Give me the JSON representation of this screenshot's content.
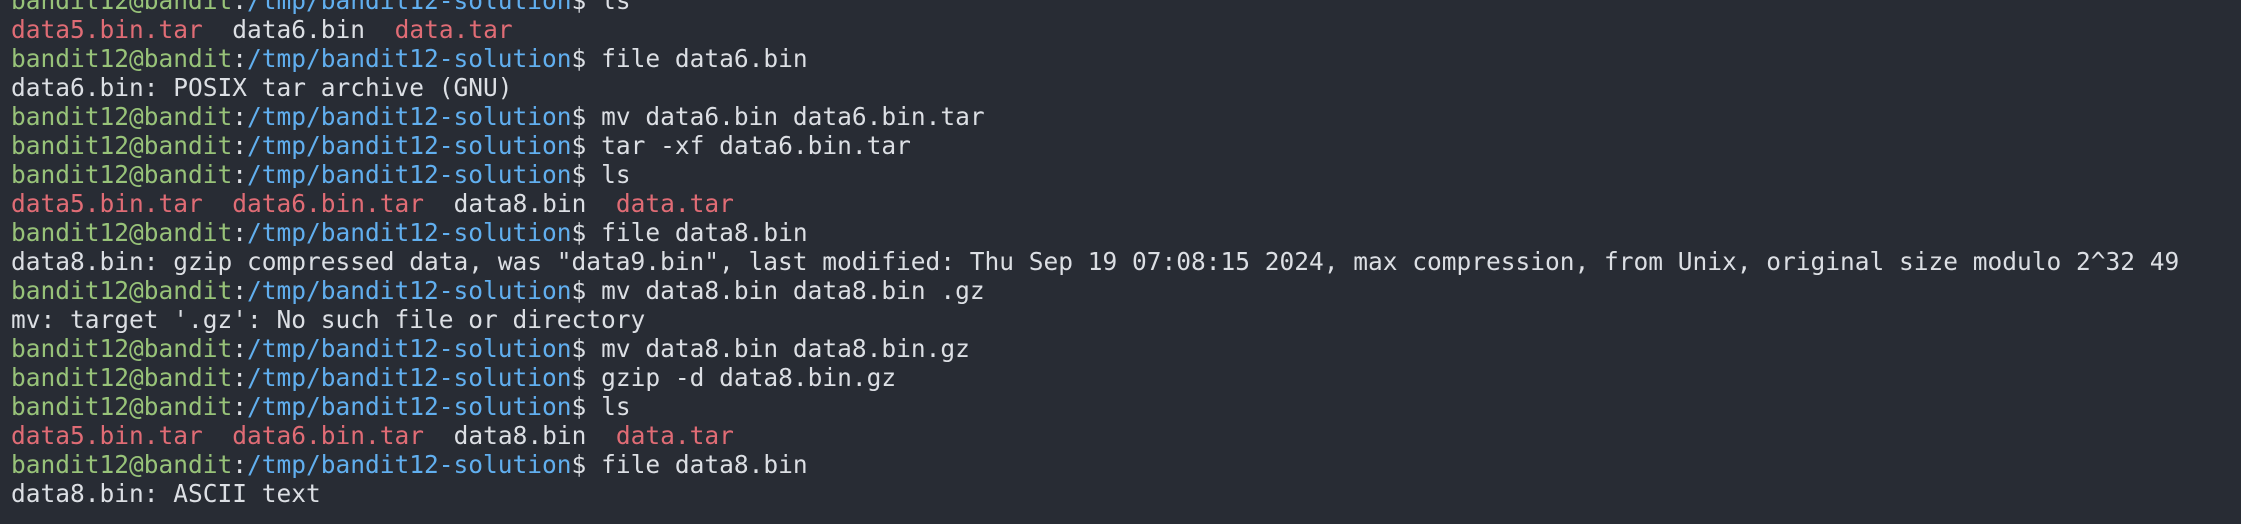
{
  "colors": {
    "background": "#282c34",
    "prompt_user": "#98c379",
    "prompt_path": "#61afef",
    "archive_file": "#e06c75",
    "text": "#dcdfe4"
  },
  "prompt": {
    "user_host": "bandit12@bandit",
    "sep": ":",
    "path": "/tmp/bandit12-solution",
    "dollar": "$ "
  },
  "lines": [
    {
      "type": "prompt",
      "cmd": "ls"
    },
    {
      "type": "ls",
      "items": [
        {
          "name": "data5.bin.tar",
          "kind": "archive"
        },
        {
          "name": "data6.bin",
          "kind": "file"
        },
        {
          "name": "data.tar",
          "kind": "archive"
        }
      ]
    },
    {
      "type": "prompt",
      "cmd": "file data6.bin"
    },
    {
      "type": "output",
      "text": "data6.bin: POSIX tar archive (GNU)"
    },
    {
      "type": "prompt",
      "cmd": "mv data6.bin data6.bin.tar"
    },
    {
      "type": "prompt",
      "cmd": "tar -xf data6.bin.tar"
    },
    {
      "type": "prompt",
      "cmd": "ls"
    },
    {
      "type": "ls",
      "items": [
        {
          "name": "data5.bin.tar",
          "kind": "archive"
        },
        {
          "name": "data6.bin.tar",
          "kind": "archive"
        },
        {
          "name": "data8.bin",
          "kind": "file"
        },
        {
          "name": "data.tar",
          "kind": "archive"
        }
      ]
    },
    {
      "type": "prompt",
      "cmd": "file data8.bin"
    },
    {
      "type": "output",
      "text": "data8.bin: gzip compressed data, was \"data9.bin\", last modified: Thu Sep 19 07:08:15 2024, max compression, from Unix, original size modulo 2^32 49"
    },
    {
      "type": "prompt",
      "cmd": "mv data8.bin data8.bin .gz"
    },
    {
      "type": "output",
      "text": "mv: target '.gz': No such file or directory"
    },
    {
      "type": "prompt",
      "cmd": "mv data8.bin data8.bin.gz"
    },
    {
      "type": "prompt",
      "cmd": "gzip -d data8.bin.gz"
    },
    {
      "type": "prompt",
      "cmd": "ls"
    },
    {
      "type": "ls",
      "items": [
        {
          "name": "data5.bin.tar",
          "kind": "archive"
        },
        {
          "name": "data6.bin.tar",
          "kind": "archive"
        },
        {
          "name": "data8.bin",
          "kind": "file"
        },
        {
          "name": "data.tar",
          "kind": "archive"
        }
      ]
    },
    {
      "type": "prompt",
      "cmd": "file data8.bin"
    },
    {
      "type": "output",
      "text": "data8.bin: ASCII text"
    }
  ]
}
